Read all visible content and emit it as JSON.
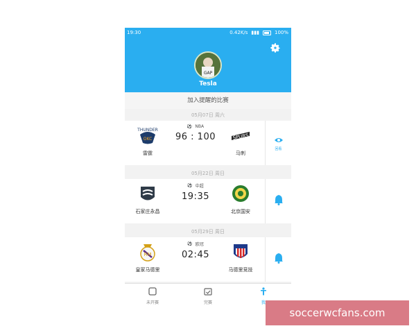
{
  "status_bar": {
    "time": "19:30",
    "network": "0.42K/s",
    "battery": "100%"
  },
  "profile": {
    "username": "Tesla",
    "avatar_text": "GAP"
  },
  "reminders": {
    "section_title": "加入提醒的比赛"
  },
  "matches": [
    {
      "date": "05月07日 周六",
      "league": "NBA",
      "home": "雷霆",
      "away": "马刺",
      "center": "96 : 100",
      "action": "eye-icon",
      "action_label": "回看"
    },
    {
      "date": "05月22日 周日",
      "league": "中超",
      "home": "石家庄永昌",
      "away": "北京国安",
      "center": "19:35",
      "action": "bell-icon",
      "action_label": ""
    },
    {
      "date": "05月29日 周日",
      "league": "欧冠",
      "home": "皇家马德里",
      "away": "马德里竞技",
      "center": "02:45",
      "action": "bell-icon",
      "action_label": ""
    }
  ],
  "tabs": [
    {
      "label": "未开赛",
      "icon": "tablet-icon"
    },
    {
      "label": "完赛",
      "icon": "calendar-check-icon"
    },
    {
      "label": "我",
      "icon": "person-icon"
    }
  ],
  "colors": {
    "accent": "#2aaef0",
    "watermark_bg": "#d97b86"
  },
  "watermark": {
    "text": "soccerwcfans.com"
  }
}
